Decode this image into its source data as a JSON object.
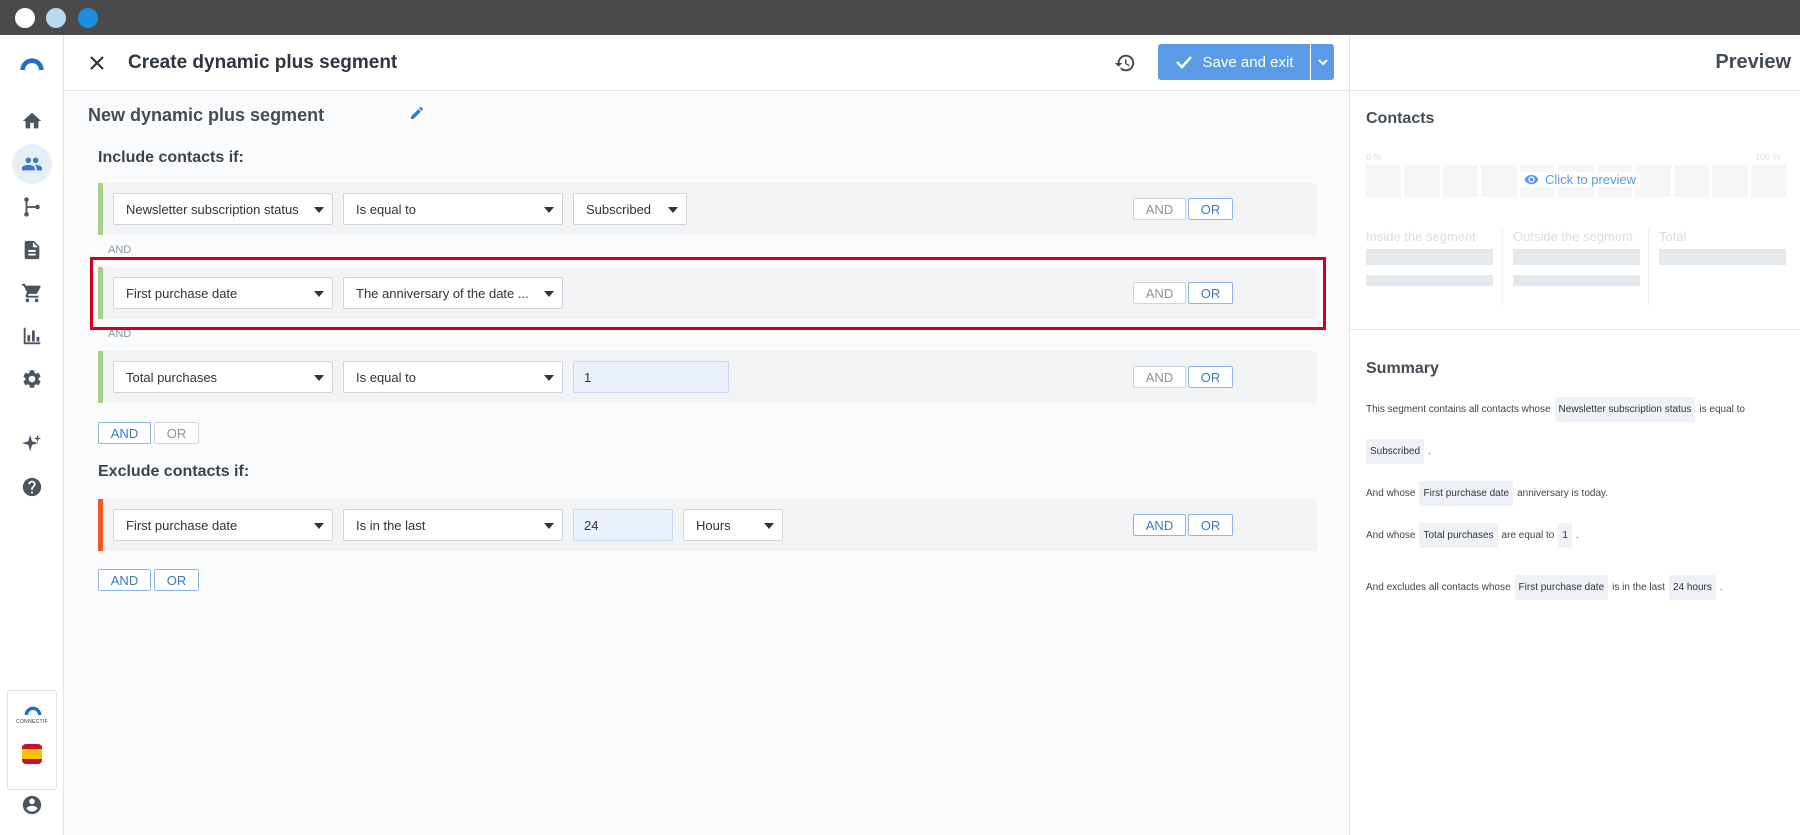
{
  "header": {
    "title": "Create dynamic plus segment",
    "save_label": "Save and exit"
  },
  "segment": {
    "name": "New dynamic plus segment"
  },
  "include": {
    "label": "Include contacts if:",
    "join_label": "AND",
    "conditions": [
      {
        "field": "Newsletter subscription status",
        "operator": "Is equal to",
        "value": "Subscribed"
      },
      {
        "field": "First purchase date",
        "operator": "The anniversary of the date ..."
      },
      {
        "field": "Total purchases",
        "operator": "Is equal to",
        "value": "1"
      }
    ]
  },
  "exclude": {
    "label": "Exclude contacts if:",
    "conditions": [
      {
        "field": "First purchase date",
        "operator": "Is in the last",
        "value": "24",
        "unit": "Hours"
      }
    ]
  },
  "logic": {
    "and_label": "AND",
    "or_label": "OR"
  },
  "preview": {
    "title": "Preview",
    "contacts_label": "Contacts",
    "pct_min": "0 %",
    "pct_max": "100 %",
    "click_label": "Click to preview",
    "inside_label": "Inside the segment",
    "outside_label": "Outside the segment",
    "total_label": "Total"
  },
  "summary": {
    "title": "Summary",
    "line1_prefix": "This segment contains all contacts whose",
    "line1_tag": "Newsletter subscription status",
    "line1_suffix": "is equal to",
    "line2_tag": "Subscribed",
    "line2_suffix": ".",
    "line3_prefix": "And whose",
    "line3_tag": "First purchase date",
    "line3_suffix": "anniversary is today.",
    "line4_prefix": "And whose",
    "line4_tag": "Total purchases",
    "line4_mid": "are equal to",
    "line4_tag2": "1",
    "line4_suffix": ".",
    "line5_prefix": "And excludes all contacts whose",
    "line5_tag": "First purchase date",
    "line5_mid": "is in the last",
    "line5_tag2": "24 hours",
    "line5_suffix": "."
  },
  "brand": {
    "text": "CONNECTIF"
  },
  "icons": [
    "logo-icon",
    "home-icon",
    "contacts-icon",
    "flows-icon",
    "content-icon",
    "cart-icon",
    "reports-icon",
    "settings-icon",
    "sparkle-icon",
    "help-icon",
    "account-icon",
    "history-icon",
    "edit-icon",
    "eye-icon"
  ],
  "colors": {
    "accent": "#5a9ae6",
    "include_bar": "#a9d08b",
    "exclude_bar": "#f05a1e",
    "highlight": "#d0021b"
  }
}
